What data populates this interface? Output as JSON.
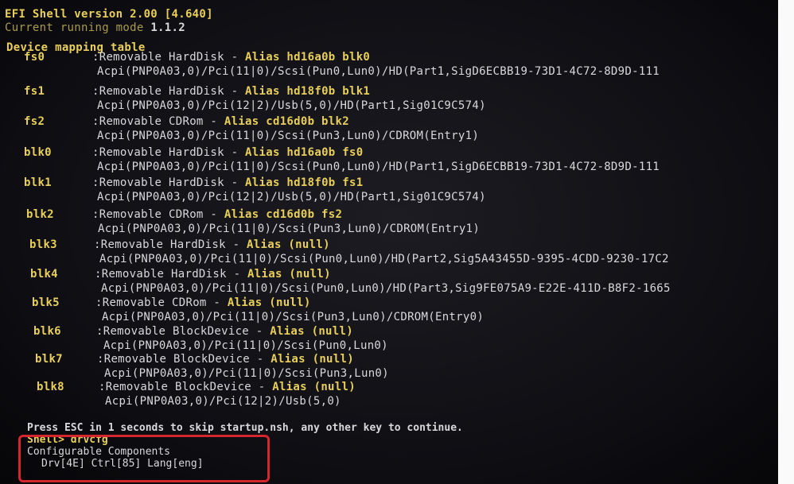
{
  "shell": {
    "banner": "EFI Shell version 2.00 [4.640]",
    "mode_label": "Current running mode",
    "mode_value": "1.1.2",
    "mapping_title": "Device mapping table"
  },
  "devices": [
    {
      "name": "fs0",
      "desc": ":Removable HardDisk - ",
      "alias": "Alias hd16a0b blk0",
      "path": "Acpi(PNP0A03,0)/Pci(11|0)/Scsi(Pun0,Lun0)/HD(Part1,SigD6ECBB19-73D1-4C72-8D9D-111"
    },
    {
      "name": "fs1",
      "desc": ":Removable HardDisk - ",
      "alias": "Alias hd18f0b blk1",
      "path": "Acpi(PNP0A03,0)/Pci(12|2)/Usb(5,0)/HD(Part1,Sig01C9C574)"
    },
    {
      "name": "fs2",
      "desc": ":Removable CDRom - ",
      "alias": "Alias cd16d0b blk2",
      "path": "Acpi(PNP0A03,0)/Pci(11|0)/Scsi(Pun3,Lun0)/CDROM(Entry1)"
    },
    {
      "name": "blk0",
      "desc": ":Removable HardDisk - ",
      "alias": "Alias hd16a0b fs0",
      "path": "Acpi(PNP0A03,0)/Pci(11|0)/Scsi(Pun0,Lun0)/HD(Part1,SigD6ECBB19-73D1-4C72-8D9D-111"
    },
    {
      "name": "blk1",
      "desc": ":Removable HardDisk - ",
      "alias": "Alias hd18f0b fs1",
      "path": "Acpi(PNP0A03,0)/Pci(12|2)/Usb(5,0)/HD(Part1,Sig01C9C574)"
    },
    {
      "name": "blk2",
      "desc": ":Removable CDRom - ",
      "alias": "Alias cd16d0b fs2",
      "path": "Acpi(PNP0A03,0)/Pci(11|0)/Scsi(Pun3,Lun0)/CDROM(Entry1)"
    },
    {
      "name": "blk3",
      "desc": ":Removable HardDisk - ",
      "alias": "Alias (null)",
      "path": "Acpi(PNP0A03,0)/Pci(11|0)/Scsi(Pun0,Lun0)/HD(Part2,Sig5A43455D-9395-4CDD-9230-17C2"
    },
    {
      "name": "blk4",
      "desc": ":Removable HardDisk - ",
      "alias": "Alias (null)",
      "path": "Acpi(PNP0A03,0)/Pci(11|0)/Scsi(Pun0,Lun0)/HD(Part3,Sig9FE075A9-E22E-411D-B8F2-1665"
    },
    {
      "name": "blk5",
      "desc": ":Removable CDRom - ",
      "alias": "Alias (null)",
      "path": "Acpi(PNP0A03,0)/Pci(11|0)/Scsi(Pun3,Lun0)/CDROM(Entry0)"
    },
    {
      "name": "blk6",
      "desc": ":Removable BlockDevice - ",
      "alias": "Alias (null)",
      "path": "Acpi(PNP0A03,0)/Pci(11|0)/Scsi(Pun0,Lun0)"
    },
    {
      "name": "blk7",
      "desc": ":Removable BlockDevice - ",
      "alias": "Alias (null)",
      "path": "Acpi(PNP0A03,0)/Pci(11|0)/Scsi(Pun3,Lun0)"
    },
    {
      "name": "blk8",
      "desc": ":Removable BlockDevice - ",
      "alias": "Alias (null)",
      "path": "Acpi(PNP0A03,0)/Pci(12|2)/Usb(5,0)"
    }
  ],
  "bottom": {
    "press_line": "Press ESC in 1 seconds to skip startup.nsh, any other key to continue.",
    "prompt": "Shell> drvcfg",
    "configurable": "Configurable Components",
    "drv": "Drv[4E]",
    "ctrl": "Ctrl[85]",
    "lang": "Lang[eng]"
  },
  "colors": {
    "highlight": "#d4262c",
    "text_yellow": "#e8cf5a",
    "text_white": "#d9d9dc"
  }
}
